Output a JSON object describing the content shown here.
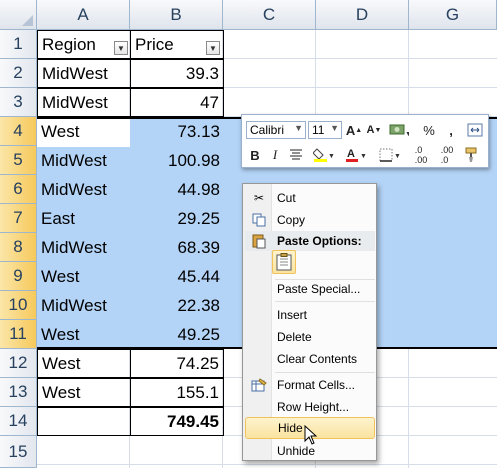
{
  "columns": [
    "A",
    "B",
    "C",
    "D",
    "G"
  ],
  "rows": [
    "1",
    "2",
    "3",
    "4",
    "5",
    "6",
    "7",
    "8",
    "9",
    "10",
    "11",
    "12",
    "13",
    "14",
    "15"
  ],
  "headers": {
    "region": "Region",
    "price": "Price"
  },
  "data": [
    {
      "region": "MidWest",
      "price": "39.3"
    },
    {
      "region": "MidWest",
      "price": "47"
    },
    {
      "region": "West",
      "price": "73.13"
    },
    {
      "region": "MidWest",
      "price": "100.98"
    },
    {
      "region": "MidWest",
      "price": "44.98"
    },
    {
      "region": "East",
      "price": "29.25"
    },
    {
      "region": "MidWest",
      "price": "68.39"
    },
    {
      "region": "West",
      "price": "45.44"
    },
    {
      "region": "MidWest",
      "price": "22.38"
    },
    {
      "region": "West",
      "price": "49.25"
    },
    {
      "region": "West",
      "price": "74.25"
    },
    {
      "region": "West",
      "price": "155.1"
    }
  ],
  "total": "749.45",
  "mini_toolbar": {
    "font": "Calibri",
    "size": "11"
  },
  "context_menu": {
    "cut": "Cut",
    "copy": "Copy",
    "paste_options": "Paste Options:",
    "paste_special": "Paste Special...",
    "insert": "Insert",
    "delete": "Delete",
    "clear_contents": "Clear Contents",
    "format_cells": "Format Cells...",
    "row_height": "Row Height...",
    "hide": "Hide",
    "unhide": "Unhide"
  },
  "colors": {
    "selection": "#b4d4f7",
    "header_selected": "#f6c95c",
    "menu_highlight": "#fbe3a0"
  }
}
